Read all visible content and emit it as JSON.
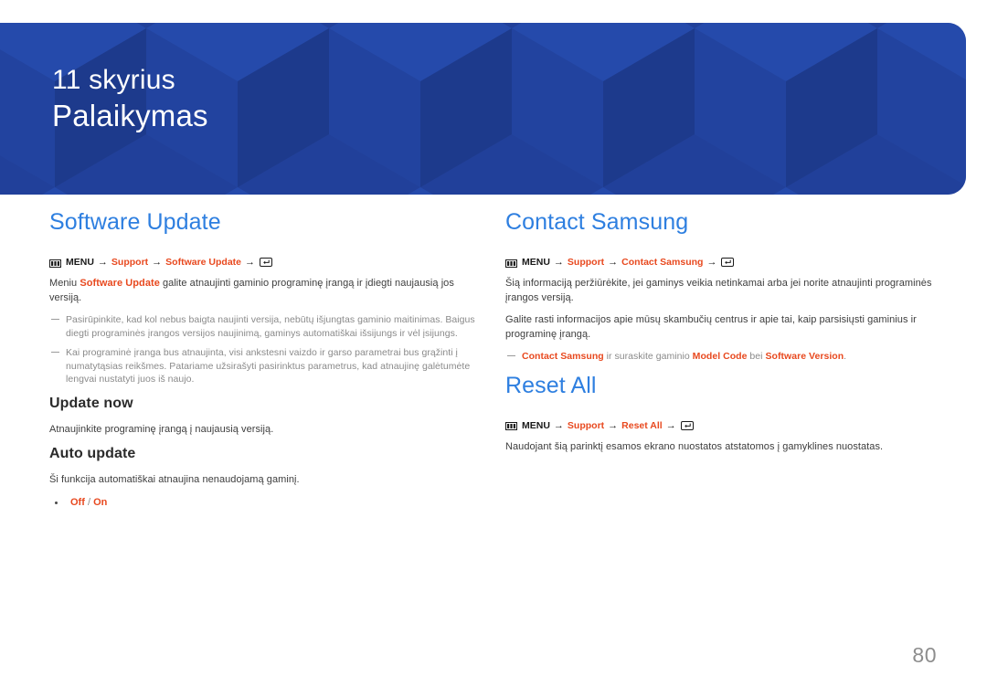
{
  "banner": {
    "chapter_number": "11 skyrius",
    "chapter_title": "Palaikymas",
    "background_color": "#21409a",
    "text_color": "#ffffff"
  },
  "colors": {
    "section_heading": "#2e7fe0",
    "highlight": "#e8491f",
    "body_text": "#3d3d3d",
    "note_text": "#8a8a8a",
    "page_number": "#8d8d8d"
  },
  "left_column": {
    "section": {
      "title": "Software Update",
      "menu_path": {
        "menu_icon": "menu-icon",
        "menu_label": "MENU",
        "arrow": "→",
        "item1": "Support",
        "item2": "Software Update",
        "enter_icon": "enter-key-icon"
      },
      "intro": {
        "pre": "Meniu ",
        "hl": "Software Update",
        "post": " galite atnaujinti gaminio programinę įrangą ir įdiegti naujausią jos versiją."
      },
      "notes": [
        "Pasirūpinkite, kad kol nebus baigta naujinti versija, nebūtų išjungtas gaminio maitinimas. Baigus diegti programinės įrangos versijos naujinimą, gaminys automatiškai išsijungs ir vėl įsijungs.",
        "Kai programinė įranga bus atnaujinta, visi ankstesni vaizdo ir garso parametrai bus grąžinti į numatytąsias reikšmes. Patariame užsirašyti pasirinktus parametrus, kad atnaujinę galėtumėte lengvai nustatyti juos iš naujo."
      ]
    },
    "update_now": {
      "title": "Update now",
      "body": "Atnaujinkite programinę įrangą į naujausią versiją."
    },
    "auto_update": {
      "title": "Auto update",
      "body": "Ši funkcija automatiškai atnaujina nenaudojamą gaminį.",
      "options": {
        "off": "Off",
        "slash": " / ",
        "on": "On"
      }
    }
  },
  "right_column": {
    "contact_samsung": {
      "title": "Contact Samsung",
      "menu_path": {
        "menu_icon": "menu-icon",
        "menu_label": "MENU",
        "arrow": "→",
        "item1": "Support",
        "item2": "Contact Samsung",
        "enter_icon": "enter-key-icon"
      },
      "paragraph1": "Šią informaciją peržiūrėkite, jei gaminys veikia netinkamai arba jei norite atnaujinti programinės įrangos versiją.",
      "paragraph2": "Galite rasti informacijos apie mūsų skambučių centrus ir apie tai, kaip parsisiųsti gaminius ir programinę įrangą.",
      "note": {
        "hl1": "Contact Samsung",
        "mid1": " ir suraskite gaminio ",
        "hl2": "Model Code",
        "mid2": " bei ",
        "hl3": "Software Version",
        "end": "."
      }
    },
    "reset_all": {
      "title": "Reset All",
      "menu_path": {
        "menu_icon": "menu-icon",
        "menu_label": "MENU",
        "arrow": "→",
        "item1": "Support",
        "item2": "Reset All",
        "enter_icon": "enter-key-icon"
      },
      "body": "Naudojant šią parinktį esamos ekrano nuostatos atstatomos į gamyklines nuostatas."
    }
  },
  "footer": {
    "page_number": "80"
  }
}
